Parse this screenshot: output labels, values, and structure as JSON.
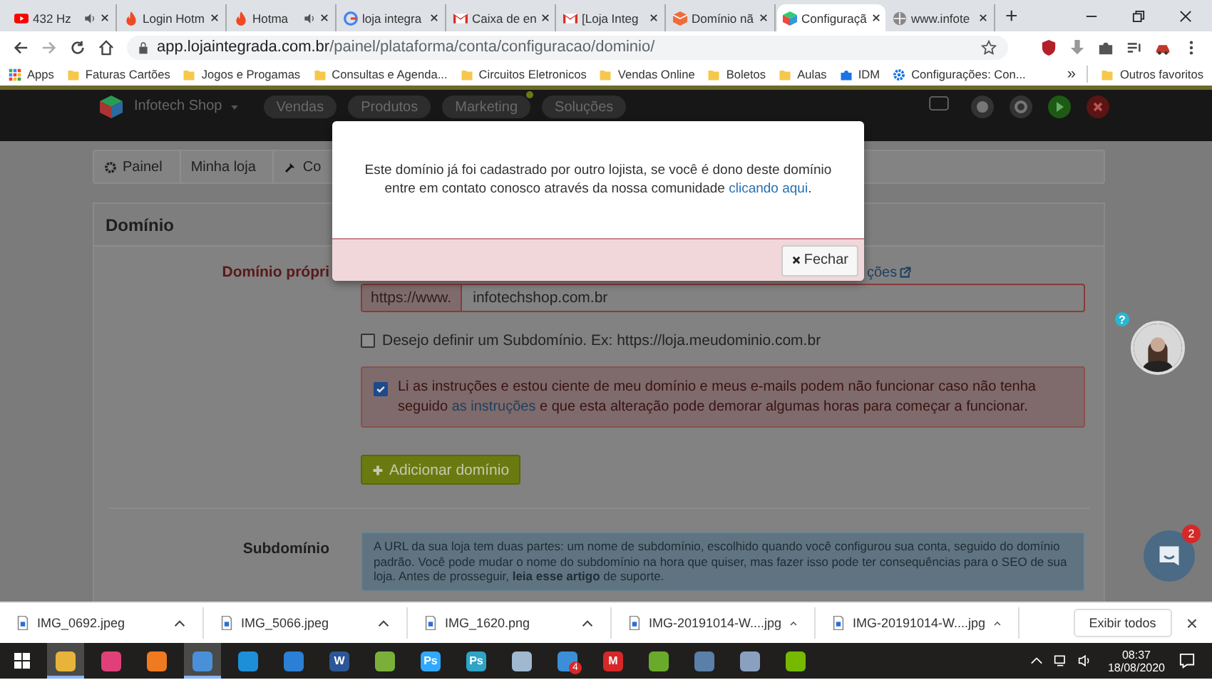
{
  "browser": {
    "tabs": [
      {
        "title": "432 Hz",
        "selected": false,
        "playing_audio": true
      },
      {
        "title": "Login Hotm",
        "selected": false,
        "playing_audio": false
      },
      {
        "title": "Hotma",
        "selected": false,
        "playing_audio": true
      },
      {
        "title": "loja integra",
        "selected": false,
        "playing_audio": false
      },
      {
        "title": "Caixa de en",
        "selected": false,
        "playing_audio": false
      },
      {
        "title": "[Loja Integ",
        "selected": false,
        "playing_audio": false
      },
      {
        "title": "Domínio nã",
        "selected": false,
        "playing_audio": false
      },
      {
        "title": "Configuraçã",
        "selected": true,
        "playing_audio": false
      },
      {
        "title": "www.infote",
        "selected": false,
        "playing_audio": false
      }
    ],
    "new_tab": "+",
    "url_host": "app.lojaintegrada.com.br",
    "url_path": "/painel/plataforma/conta/configuracao/dominio/"
  },
  "bookmarks": {
    "items": [
      {
        "label": "Apps",
        "kind": "apps"
      },
      {
        "label": "Faturas Cartões",
        "kind": "folder"
      },
      {
        "label": "Jogos e Progamas",
        "kind": "folder"
      },
      {
        "label": "Consultas e Agenda...",
        "kind": "folder"
      },
      {
        "label": "Circuitos Eletronicos",
        "kind": "folder"
      },
      {
        "label": "Vendas Online",
        "kind": "folder"
      },
      {
        "label": "Boletos",
        "kind": "folder"
      },
      {
        "label": "Aulas",
        "kind": "folder"
      },
      {
        "label": "IDM",
        "kind": "puzzle"
      },
      {
        "label": "Configurações: Con...",
        "kind": "gear"
      }
    ],
    "more": "»",
    "other": "Outros favoritos"
  },
  "app": {
    "store": "Infotech Shop",
    "nav": [
      {
        "label": "Vendas",
        "notification": false
      },
      {
        "label": "Produtos",
        "notification": false
      },
      {
        "label": "Marketing",
        "notification": true
      },
      {
        "label": "Soluções",
        "notification": false
      }
    ],
    "breadcrumb": [
      "Painel",
      "Minha loja",
      "Co"
    ],
    "panel": {
      "title": "Domínio",
      "own_domain": {
        "label": "Domínio própri",
        "help_link": "ções",
        "prefix": "https://www.",
        "value": "infotechshop.com.br",
        "subdomain_option": {
          "label": "Desejo definir um Subdomínio. Ex: https://loja.meudominio.com.br",
          "checked": false
        },
        "agreement": {
          "checked": true,
          "text_before": "Li as instruções e estou ciente de meu domínio e meus e-mails podem não funcionar caso não tenha seguido",
          "link": "as instruções",
          "text_after": "e que esta alteração pode demorar algumas horas para começar a funcionar."
        },
        "add_button": "Adicionar domínio"
      },
      "subdomain": {
        "label": "Subdomínio",
        "info_before": "A URL da sua loja tem duas partes: um nome de subdomínio, escolhido quando você configurou sua conta, seguido do domínio padrão. Você pode mudar o nome do subdomínio na hora que quiser, mas fazer isso pode ter consequências para o SEO de sua loja. Antes de prosseguir,",
        "info_link": "leia esse artigo",
        "info_after": "de suporte."
      }
    }
  },
  "modal": {
    "message_before": "Este domínio já foi cadastrado por outro lojista, se você é dono deste domínio entre em contato conosco através da nossa comunidade",
    "link": "clicando aqui",
    "message_after": ".",
    "close_button": "Fechar"
  },
  "help_widget": {
    "badge": "?"
  },
  "chat": {
    "badge": "2"
  },
  "downloads": {
    "files": [
      "IMG_0692.jpeg",
      "IMG_5066.jpeg",
      "IMG_1620.png",
      "IMG-20191014-W....jpg",
      "IMG-20191014-W....jpg"
    ],
    "show_all": "Exibir todos",
    "close": "×"
  },
  "taskbar": {
    "apps": [
      {
        "active": true
      },
      {
        "active": false
      },
      {
        "active": false
      },
      {
        "active": true
      },
      {
        "active": false
      },
      {
        "active": false
      },
      {
        "active": false,
        "label": "W"
      },
      {
        "active": false
      },
      {
        "active": false,
        "label": "Ps"
      },
      {
        "active": false,
        "label": "Ps"
      },
      {
        "active": false
      },
      {
        "active": false,
        "badge": "4"
      },
      {
        "active": false,
        "label": "M"
      },
      {
        "active": false
      },
      {
        "active": false
      },
      {
        "active": false
      },
      {
        "active": false
      }
    ],
    "time": "08:37",
    "date": "18/08/2020"
  }
}
